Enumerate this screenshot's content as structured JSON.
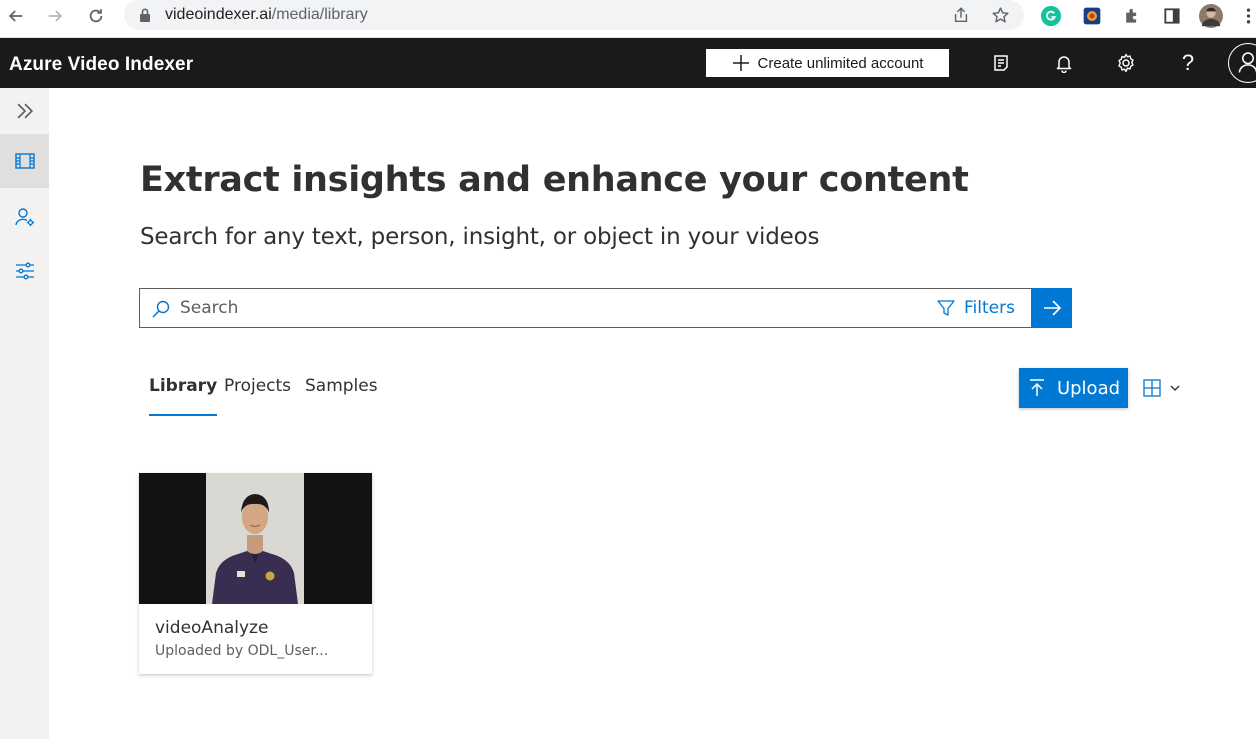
{
  "browser": {
    "url_host": "videoindexer.ai",
    "url_path": "/media/library"
  },
  "header": {
    "app_title": "Azure Video Indexer",
    "create_account_label": "Create unlimited account",
    "help_label": "?"
  },
  "hero": {
    "title": "Extract insights and enhance your content",
    "subtitle": "Search for any text, person, insight, or object in your videos"
  },
  "search": {
    "placeholder": "Search",
    "value": "",
    "filters_label": "Filters"
  },
  "tabs": [
    {
      "label": "Library",
      "active": true
    },
    {
      "label": "Projects",
      "active": false
    },
    {
      "label": "Samples",
      "active": false
    }
  ],
  "toolbar": {
    "upload_label": "Upload"
  },
  "videos": [
    {
      "title": "videoAnalyze",
      "subtitle": "Uploaded by ODL_User..."
    }
  ],
  "colors": {
    "accent": "#0078d4",
    "appbar": "#1b1a19",
    "rail": "#f3f2f1"
  }
}
